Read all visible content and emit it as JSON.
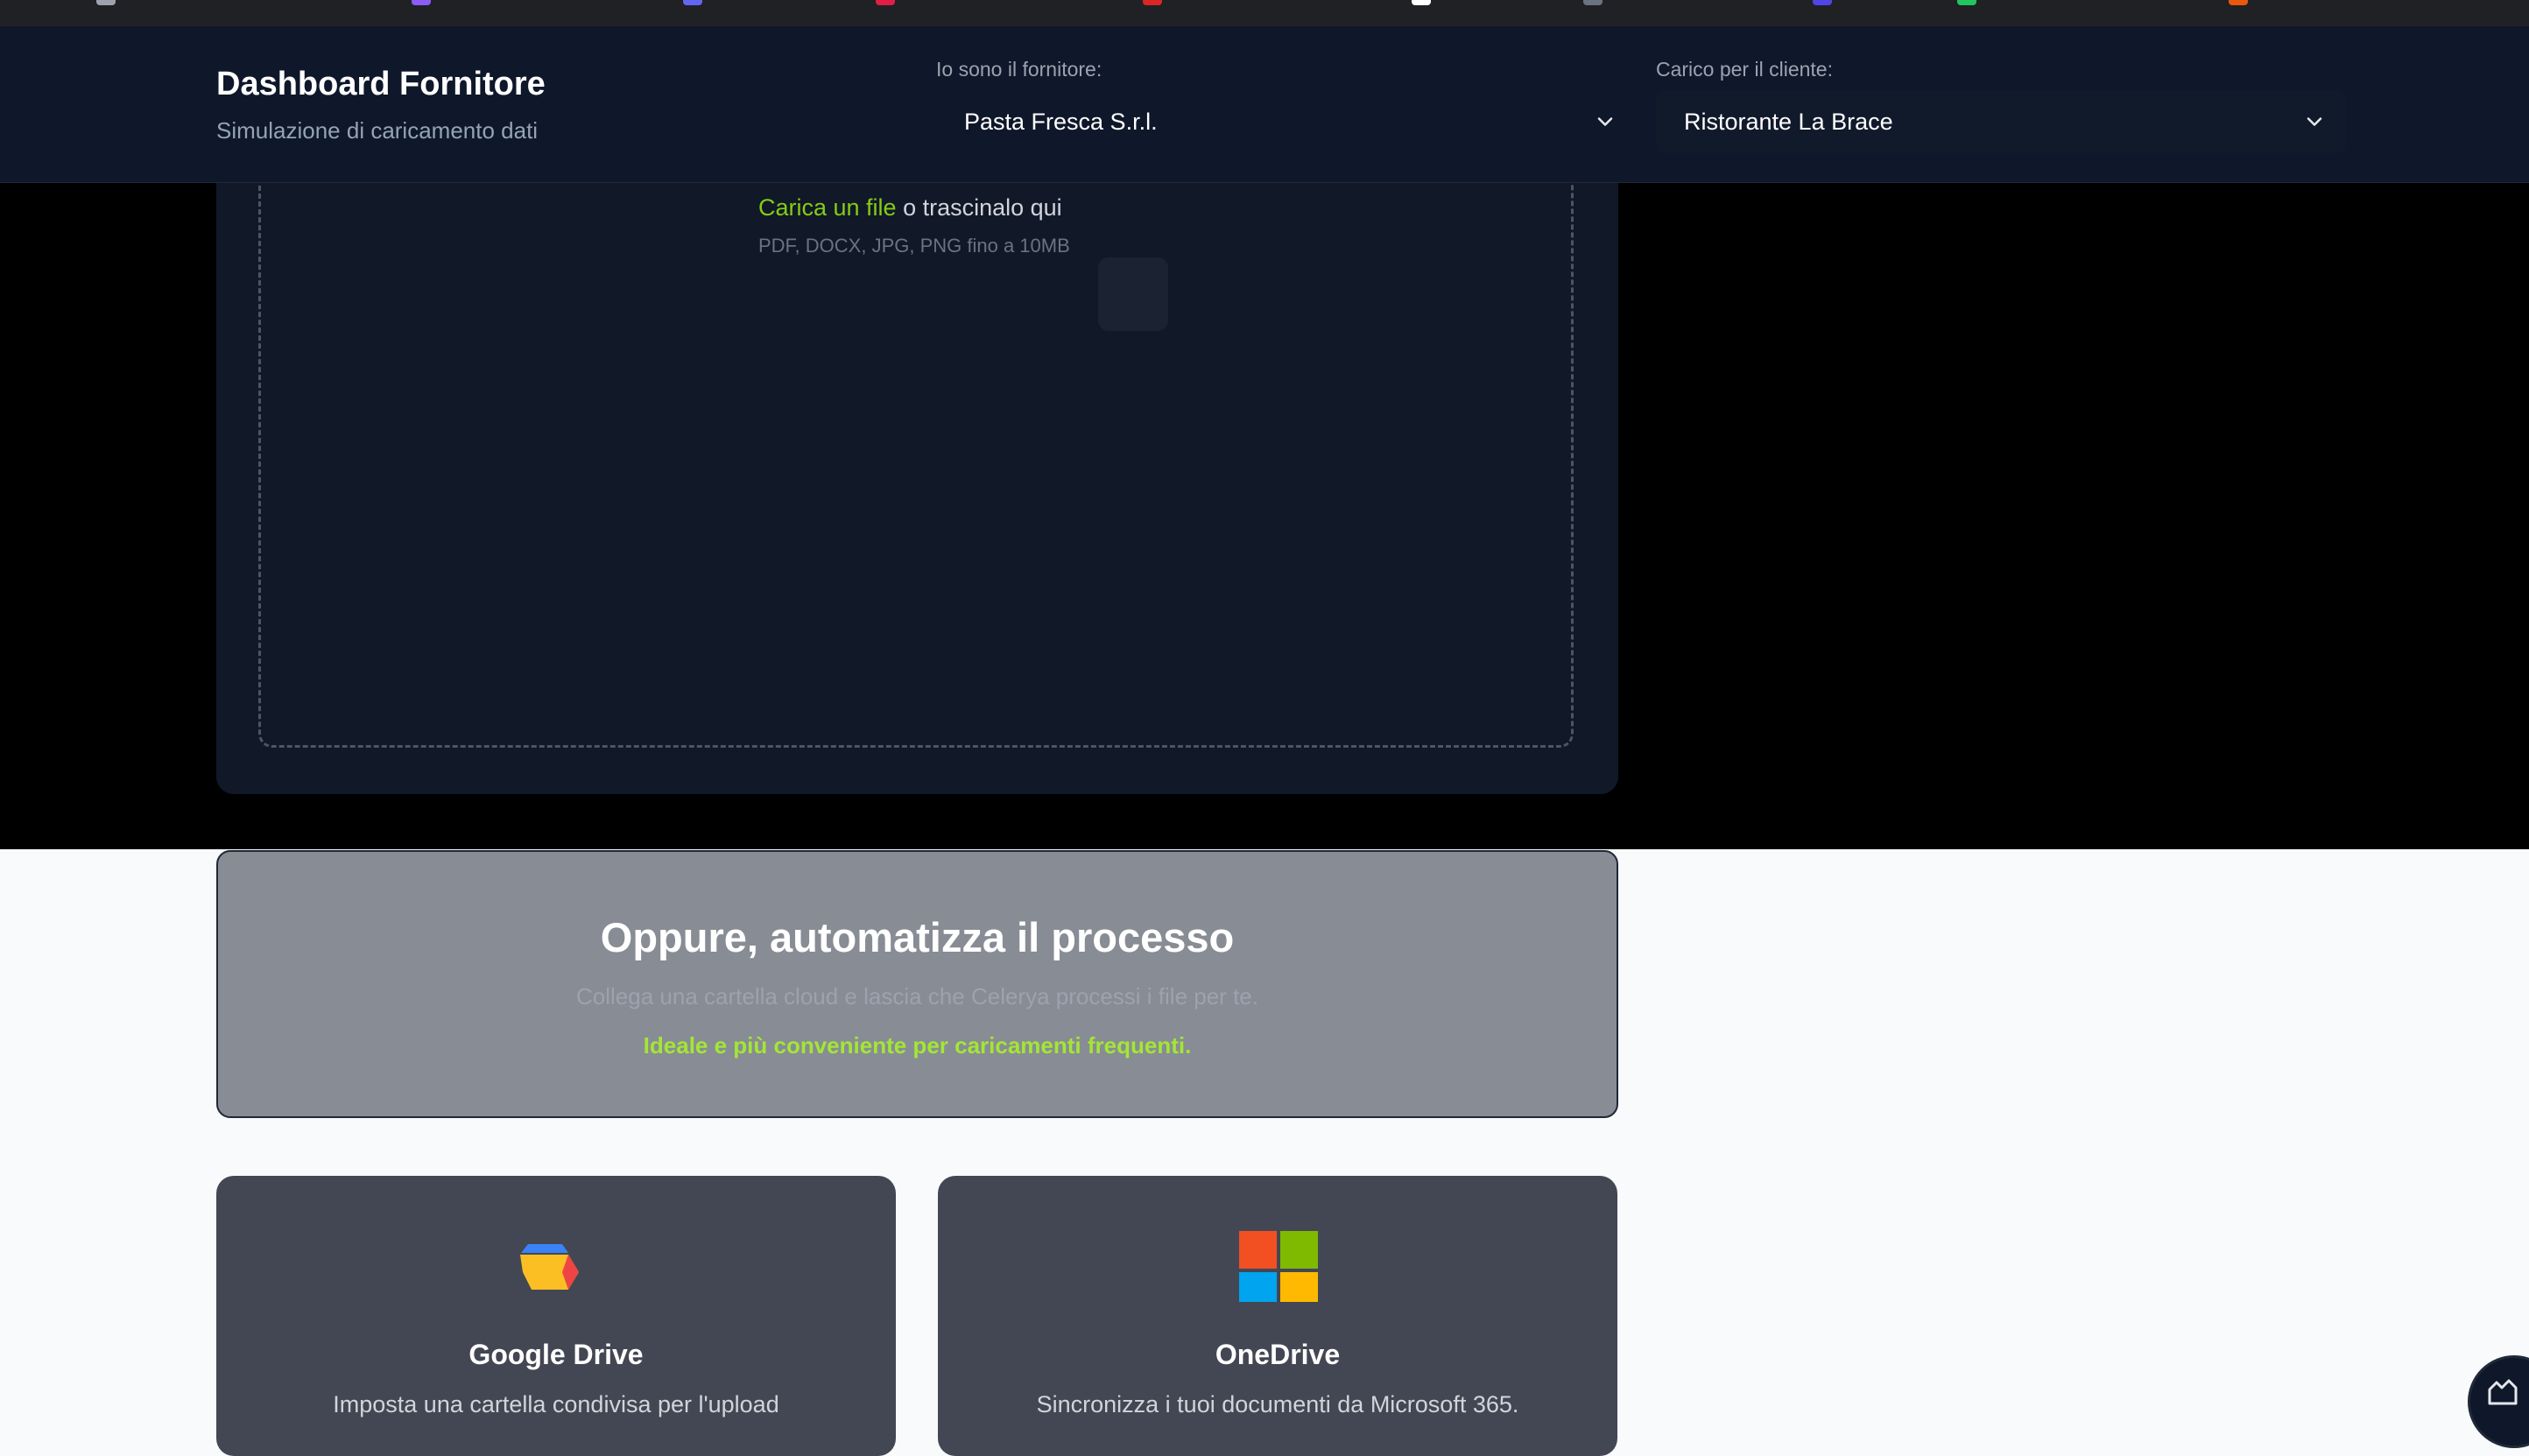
{
  "header": {
    "title": "Dashboard Fornitore",
    "subtitle": "Simulazione di caricamento dati",
    "supplier_label": "Io sono il fornitore:",
    "supplier_value": "Pasta Fresca S.r.l.",
    "client_label": "Carico per il cliente:",
    "client_value": "Ristorante La Brace"
  },
  "upload": {
    "link_text": "Carica un file",
    "rest_text": " o trascinalo qui",
    "hint": "PDF, DOCX, JPG, PNG fino a 10MB"
  },
  "automate": {
    "title": "Oppure, automatizza il processo",
    "subtitle": "Collega una cartella cloud e lascia che Celerya processi i file per te.",
    "note": "Ideale e più conveniente per caricamenti frequenti."
  },
  "providers": [
    {
      "name": "Google Drive",
      "description": "Imposta una cartella condivisa per l'upload",
      "icon": "google-drive-icon"
    },
    {
      "name": "OneDrive",
      "description": "Sincronizza i tuoi documenti da Microsoft 365.",
      "icon": "microsoft-icon"
    }
  ],
  "colors": {
    "accent": "#84cc16",
    "header_bg": "#0f172a",
    "card_bg": "#111827",
    "provider_bg": "#434753"
  }
}
